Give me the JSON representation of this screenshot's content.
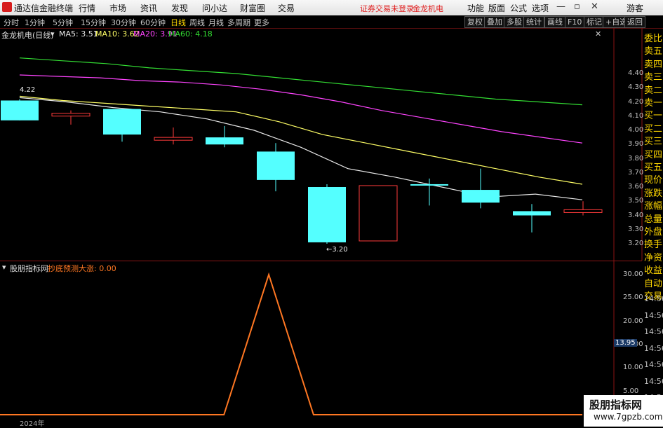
{
  "titlebar": {
    "app_title": "通达信金融终端",
    "menu": [
      "行情",
      "市场",
      "资讯",
      "发现",
      "问小达",
      "财富圈",
      "交易"
    ],
    "status": "证券交易未登录",
    "stock_name": "金龙机电",
    "buttons": [
      "功能",
      "版面",
      "公式",
      "选项"
    ],
    "guest": "游客"
  },
  "periods": {
    "items": [
      "分时",
      "1分钟",
      "5分钟",
      "15分钟",
      "30分钟",
      "60分钟",
      "日线",
      "周线",
      "月线",
      "多周期",
      "更多"
    ],
    "active": "日线",
    "right_buttons": [
      "复权",
      "叠加",
      "多股",
      "统计",
      "画线",
      "F10",
      "标记",
      "+自选",
      "返回"
    ]
  },
  "main_chart": {
    "title": "金龙机电(日线)",
    "ma": [
      {
        "label": "MA5: 3.51",
        "color": "#e8e8e8"
      },
      {
        "label": "MA10: 3.62",
        "color": "#ffff66"
      },
      {
        "label": "MA20: 3.91",
        "color": "#ff44ff"
      },
      {
        "label": "MA60: 4.18",
        "color": "#33dd33"
      }
    ],
    "high_label": "4.22",
    "low_label": "3.20",
    "axis_ticks": [
      "4.40",
      "4.30",
      "4.20",
      "4.10",
      "4.00",
      "3.90",
      "3.80",
      "3.70",
      "3.60",
      "3.50",
      "3.40",
      "3.30",
      "3.20"
    ]
  },
  "chart_data": [
    {
      "type": "candlestick",
      "title": "金龙机电(日线)",
      "ylim": [
        3.15,
        4.52
      ],
      "candles": [
        {
          "open": 4.21,
          "close": 4.07,
          "high": 4.22,
          "low": 4.07
        },
        {
          "open": 4.1,
          "close": 4.12,
          "high": 4.14,
          "low": 4.04
        },
        {
          "open": 4.15,
          "close": 3.97,
          "high": 4.15,
          "low": 3.92
        },
        {
          "open": 3.93,
          "close": 3.95,
          "high": 4.02,
          "low": 3.9
        },
        {
          "open": 3.95,
          "close": 3.9,
          "high": 4.03,
          "low": 3.88
        },
        {
          "open": 3.85,
          "close": 3.65,
          "high": 3.91,
          "low": 3.57
        },
        {
          "open": 3.6,
          "close": 3.21,
          "high": 3.62,
          "low": 3.2
        },
        {
          "open": 3.22,
          "close": 3.61,
          "high": 3.61,
          "low": 3.22
        },
        {
          "open": 3.62,
          "close": 3.61,
          "high": 3.66,
          "low": 3.47
        },
        {
          "open": 3.58,
          "close": 3.49,
          "high": 3.73,
          "low": 3.45
        },
        {
          "open": 3.43,
          "close": 3.4,
          "high": 3.48,
          "low": 3.28
        },
        {
          "open": 3.42,
          "close": 3.44,
          "high": 3.5,
          "low": 3.4
        }
      ],
      "series": [
        {
          "name": "MA5",
          "color": "#e8e8e8",
          "values": [
            4.23,
            4.2,
            4.16,
            4.13,
            4.08,
            4.0,
            3.88,
            3.73,
            3.67,
            3.6,
            3.53,
            3.55,
            3.51
          ]
        },
        {
          "name": "MA10",
          "color": "#ffff66",
          "values": [
            4.24,
            4.21,
            4.19,
            4.17,
            4.15,
            4.13,
            4.06,
            3.97,
            3.91,
            3.85,
            3.79,
            3.73,
            3.67,
            3.62
          ]
        },
        {
          "name": "MA20",
          "color": "#ff44ff",
          "values": [
            4.39,
            4.38,
            4.37,
            4.35,
            4.34,
            4.32,
            4.29,
            4.25,
            4.2,
            4.14,
            4.09,
            4.04,
            3.99,
            3.95,
            3.91
          ]
        },
        {
          "name": "MA60",
          "color": "#33dd33",
          "values": [
            4.51,
            4.49,
            4.47,
            4.44,
            4.42,
            4.4,
            4.37,
            4.34,
            4.31,
            4.28,
            4.25,
            4.22,
            4.2,
            4.18
          ]
        }
      ]
    },
    {
      "type": "line",
      "title": "股朋指标网",
      "series": [
        {
          "name": "抄底预测大涨: 0.00",
          "color": "#ff7722",
          "values": [
            0,
            0,
            0,
            0,
            0,
            0,
            30,
            0,
            0,
            0,
            0,
            0,
            0,
            0
          ]
        }
      ],
      "ylim": [
        0,
        31
      ],
      "ticks": [
        "30.00",
        "25.00",
        "20.00",
        "15.00",
        "10.00",
        "5.00"
      ]
    }
  ],
  "sub_chart": {
    "title": "股朋指标网",
    "indicator": "抄底预测大涨: 0.00",
    "current_value": "13.95",
    "year": "2024年"
  },
  "side_panel": {
    "labels": [
      "委比",
      "卖五",
      "卖四",
      "卖三",
      "卖二",
      "卖一",
      "买一",
      "买二",
      "买三",
      "买四",
      "买五",
      "现价",
      "涨跌",
      "涨幅",
      "总量",
      "外盘",
      "换手",
      "净资",
      "收益",
      "自动",
      "交易"
    ],
    "times": [
      "14:56",
      "14:56",
      "14:56",
      "14:56",
      "14:56",
      "14:56",
      "14:56"
    ]
  },
  "watermark": {
    "title": "股朋指标网",
    "url": "www.7gpzb.com"
  }
}
